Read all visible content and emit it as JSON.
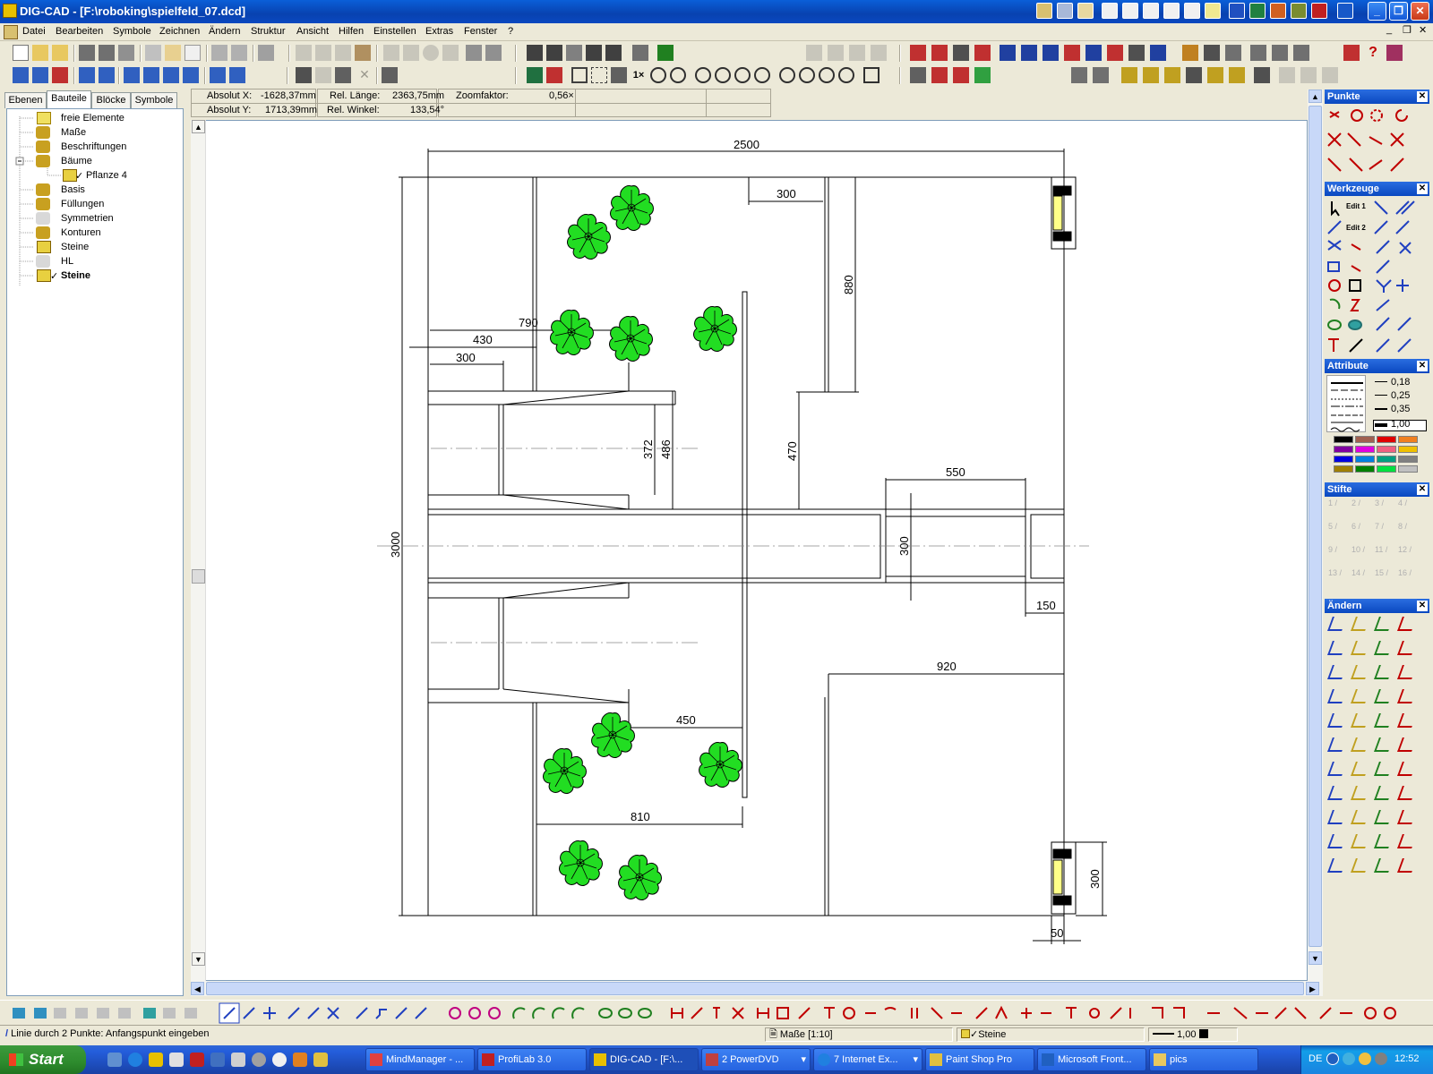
{
  "window": {
    "title": "DIG-CAD - [F:\\roboking\\spielfeld_07.dcd]"
  },
  "menu": [
    "Datei",
    "Bearbeiten",
    "Symbole",
    "Zeichnen",
    "Ändern",
    "Struktur",
    "Ansicht",
    "Hilfen",
    "Einstellen",
    "Extras",
    "Fenster",
    "?"
  ],
  "left_panel": {
    "tabs": [
      "Ebenen",
      "Bauteile",
      "Blöcke",
      "Symbole"
    ],
    "active_tab": "Bauteile",
    "tree": [
      {
        "label": "freie Elemente",
        "level": 1,
        "icon": "folder-icon"
      },
      {
        "label": "Maße",
        "level": 1,
        "icon": "component-icon"
      },
      {
        "label": "Beschriftungen",
        "level": 1,
        "icon": "component-icon"
      },
      {
        "label": "Bäume",
        "level": 1,
        "icon": "component-icon",
        "expanded": true
      },
      {
        "label": "Pflanze 4",
        "level": 2,
        "icon": "cube-icon",
        "checked": true
      },
      {
        "label": "Basis",
        "level": 1,
        "icon": "component-icon"
      },
      {
        "label": "Füllungen",
        "level": 1,
        "icon": "component-icon"
      },
      {
        "label": "Symmetrien",
        "level": 1,
        "icon": "component-icon-grey"
      },
      {
        "label": "Konturen",
        "level": 1,
        "icon": "component-icon"
      },
      {
        "label": "Steine",
        "level": 1,
        "icon": "cube-icon"
      },
      {
        "label": "HL",
        "level": 1,
        "icon": "component-icon-grey"
      },
      {
        "label": "Steine",
        "level": 1,
        "icon": "cube-icon",
        "checked": true,
        "bold": true
      }
    ]
  },
  "coords": {
    "absx_label": "Absolut X:",
    "absx_value": "-1628,37mm",
    "absy_label": "Absolut Y:",
    "absy_value": "1713,39mm",
    "rel_len_label": "Rel. Länge:",
    "rel_len_value": "2363,75mm",
    "rel_ang_label": "Rel. Winkel:",
    "rel_ang_value": "133,54°",
    "zoom_label": "Zoomfaktor:",
    "zoom_value": "0,56×"
  },
  "drawing": {
    "dims": {
      "d2500": "2500",
      "d300a": "300",
      "d880": "880",
      "d790": "790",
      "d430": "430",
      "d300b": "300",
      "d372": "372",
      "d486": "486",
      "d470": "470",
      "d550": "550",
      "d3000": "3000",
      "d300c": "300",
      "d150": "150",
      "d920": "920",
      "d450": "450",
      "d810": "810",
      "d300d": "300",
      "d50": "50"
    }
  },
  "right_panel": {
    "punkte_title": "Punkte",
    "werkzeuge_title": "Werkzeuge",
    "attribute_title": "Attribute",
    "stifte_title": "Stifte",
    "aendern_title": "Ändern",
    "line_widths": [
      "0,18",
      "0,25",
      "0,35",
      "1,00"
    ],
    "edit1": "Edit 1",
    "edit2": "Edit 2",
    "pen_numbers": [
      "1",
      "2",
      "3",
      "4",
      "5",
      "6",
      "7",
      "8",
      "9",
      "10",
      "11",
      "12",
      "13",
      "14",
      "15",
      "16"
    ],
    "palette": [
      "#000000",
      "#a06050",
      "#e00000",
      "#f08020",
      "#8000a0",
      "#e000e0",
      "#f06080",
      "#f0c000",
      "#0000e0",
      "#0080e0",
      "#00a080",
      "#808080",
      "#a08000",
      "#008000",
      "#00e040",
      "#c0c0c0"
    ]
  },
  "status": {
    "hint": "Linie durch 2 Punkte: Anfangspunkt eingeben",
    "layer": "Maße [1:10]",
    "component": "Steine",
    "linewidth": "1,00"
  },
  "taskbar": {
    "start": "Start",
    "tasks": [
      "MindManager - ...",
      "ProfiLab 3.0",
      "DIG-CAD - [F:\\...",
      "2 PowerDVD",
      "7 Internet Ex...",
      "Paint Shop Pro",
      "Microsoft Front...",
      "pics"
    ],
    "active_task": "DIG-CAD - [F:\\...",
    "lang": "DE",
    "clock": "12:52"
  }
}
